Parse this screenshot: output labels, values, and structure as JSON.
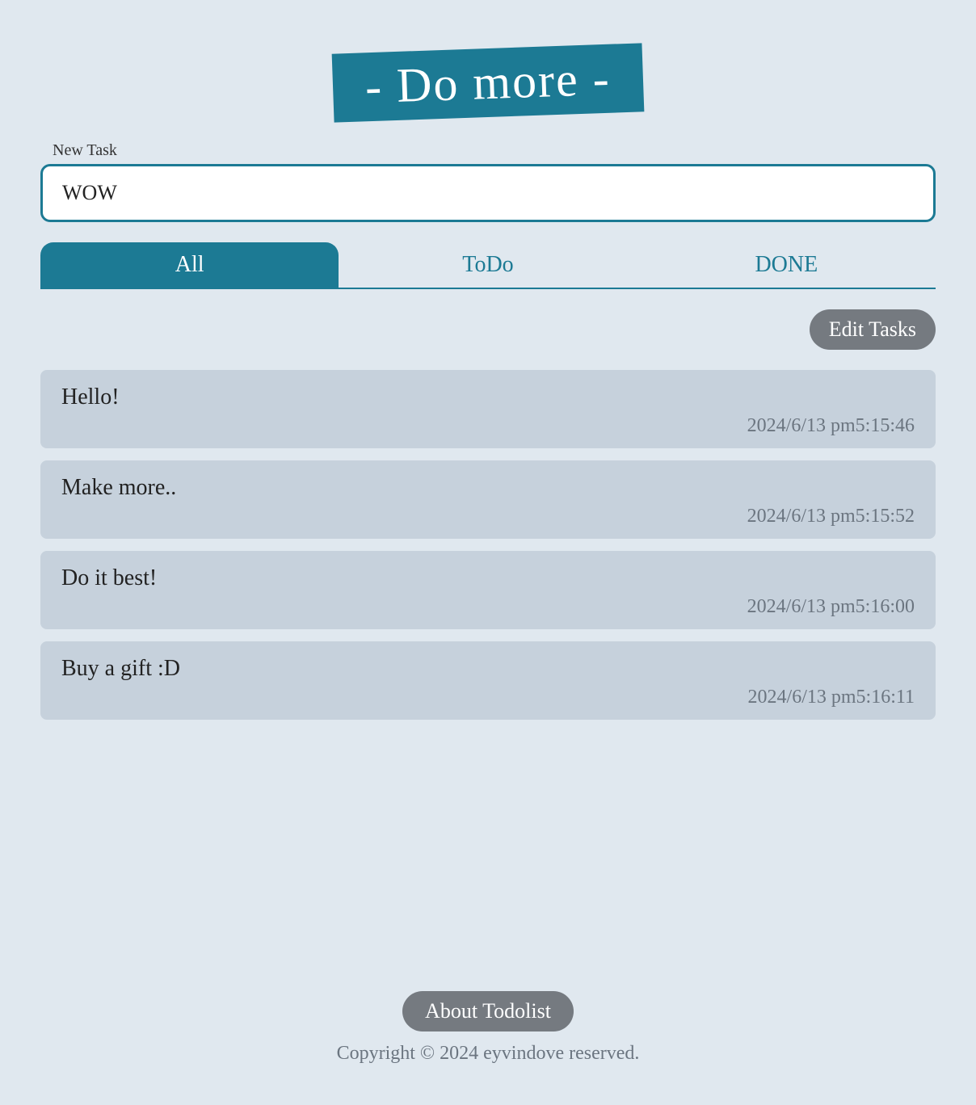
{
  "header": {
    "title": "- Do more -"
  },
  "input": {
    "label": "New Task",
    "value": "WOW"
  },
  "tabs": {
    "all": "All",
    "todo": "ToDo",
    "done": "DONE",
    "active": "all"
  },
  "buttons": {
    "edit": "Edit Tasks",
    "about": "About Todolist"
  },
  "tasks": [
    {
      "title": "Hello!",
      "time": "2024/6/13 pm5:15:46"
    },
    {
      "title": "Make more..",
      "time": "2024/6/13 pm5:15:52"
    },
    {
      "title": "Do it best!",
      "time": "2024/6/13 pm5:16:00"
    },
    {
      "title": "Buy a gift :D",
      "time": "2024/6/13 pm5:16:11"
    }
  ],
  "footer": {
    "copyright": "Copyright © 2024 eyvindove reserved."
  }
}
